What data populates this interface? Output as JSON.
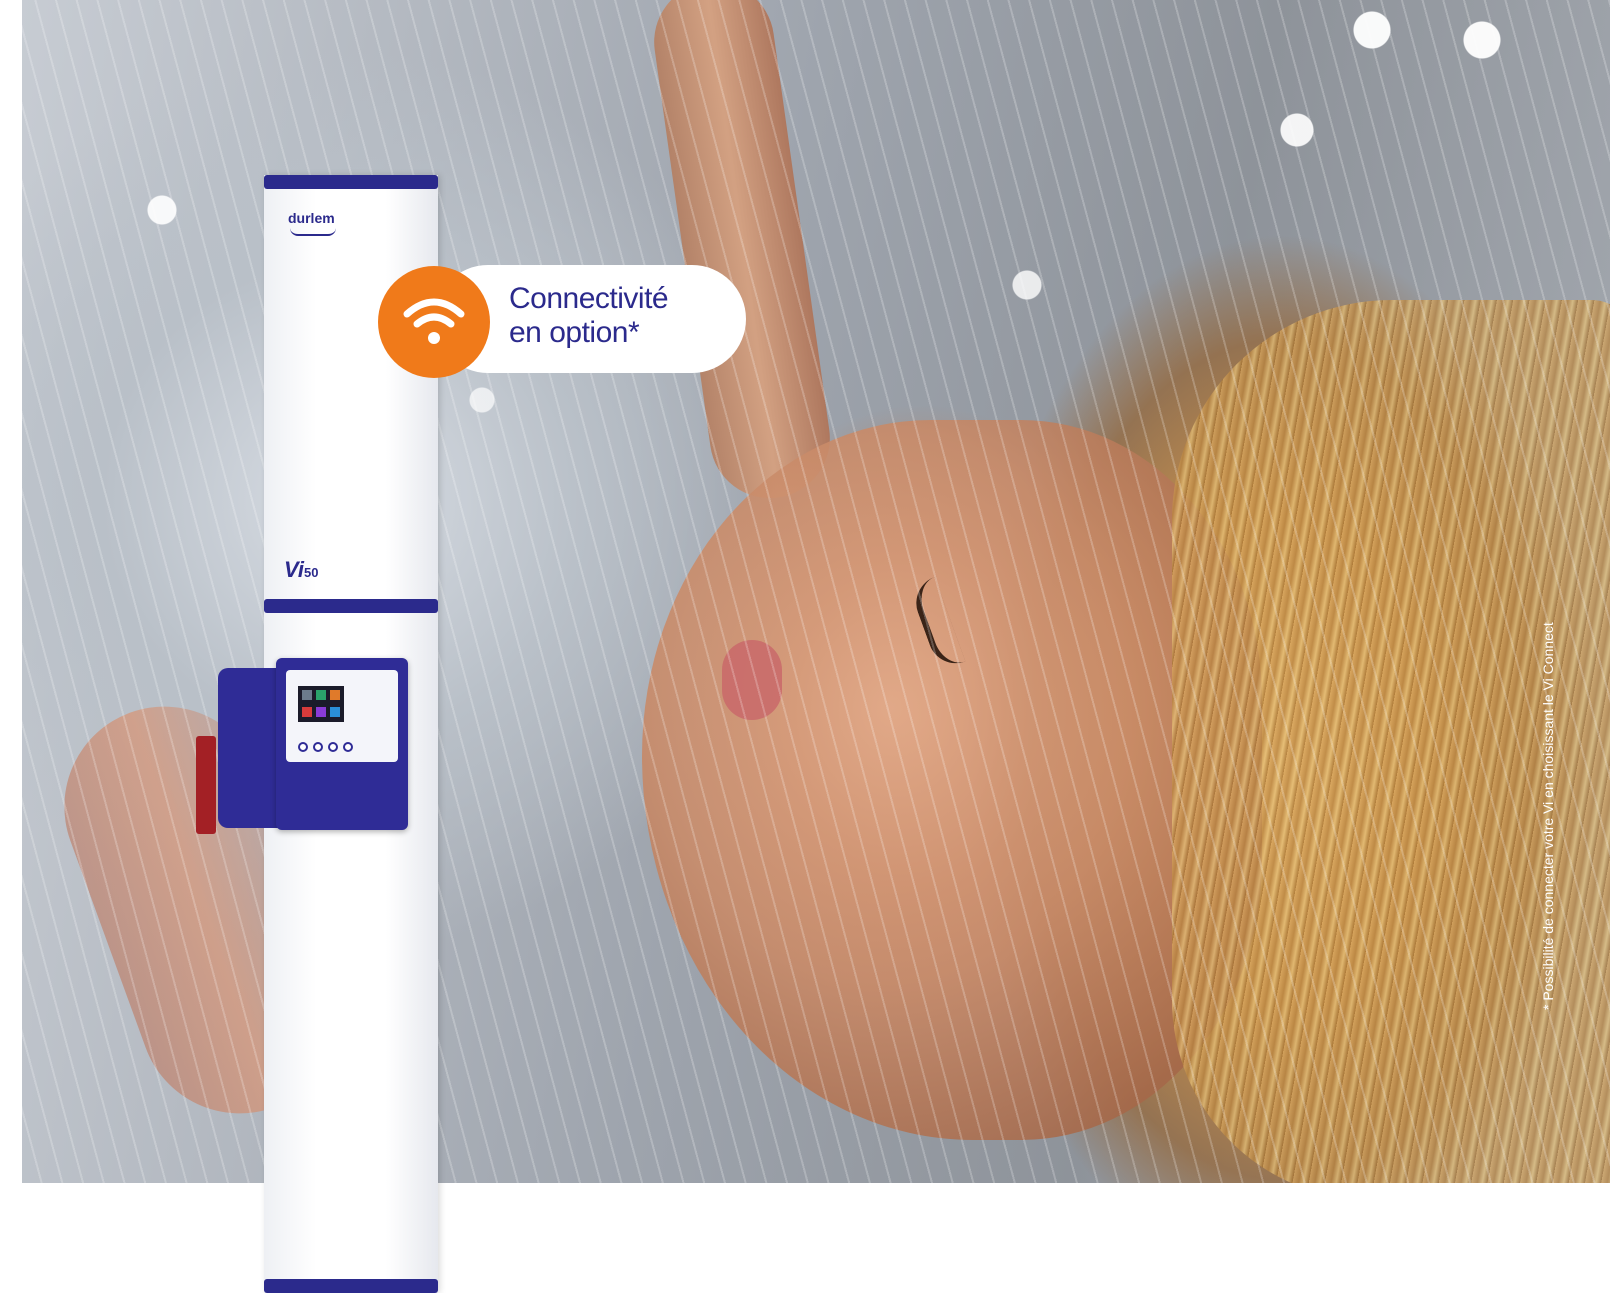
{
  "brand": "durlem",
  "model": {
    "name": "Vi",
    "number": "50"
  },
  "badge": {
    "line1": "Connectivité",
    "line2": "en option*"
  },
  "footnote": "* Possibilité de connecter votre Vi en choisissant le Vi Connect",
  "colors": {
    "accent_orange": "#f07a1a",
    "brand_blue": "#2b2a8c"
  },
  "icons": [
    "wifi-icon"
  ]
}
